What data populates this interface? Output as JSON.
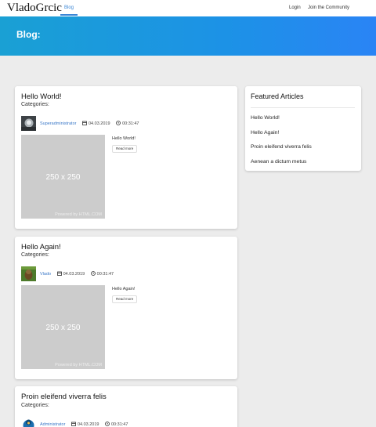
{
  "nav": {
    "brand": "VladoGrcic",
    "blog": "Blog",
    "login": "Login",
    "join": "Join the Community"
  },
  "hero": {
    "title": "Blog:"
  },
  "posts": [
    {
      "title": "Hello World!",
      "categories_label": "Categories:",
      "author": "Superadministrator",
      "date": "04.03.2019",
      "time": "00:31:47",
      "image_text": "250 x 250",
      "image_watermark": "Powered by HTML.COM",
      "excerpt": "Hello World!",
      "read_more": "Read more"
    },
    {
      "title": "Hello Again!",
      "categories_label": "Categories:",
      "author": "Vlado",
      "date": "04.03.2019",
      "time": "00:31:47",
      "image_text": "250 x 250",
      "image_watermark": "Powered by HTML.COM",
      "excerpt": "Hello Again!",
      "read_more": "Read more"
    },
    {
      "title": "Proin eleifend viverra felis",
      "categories_label": "Categories:",
      "author": "Administrator",
      "date": "04.03.2019",
      "time": "00:31:47"
    }
  ],
  "featured": {
    "title": "Featured Articles",
    "items": [
      "Hello World!",
      "Hello Again!",
      "Proin eleifend viverra felis",
      "Aenean a dictum metus"
    ]
  },
  "colors": {
    "accent": "#3a86d6",
    "hero_start": "#1aa0d4",
    "hero_end": "#2a84f5",
    "background": "#ececec"
  }
}
